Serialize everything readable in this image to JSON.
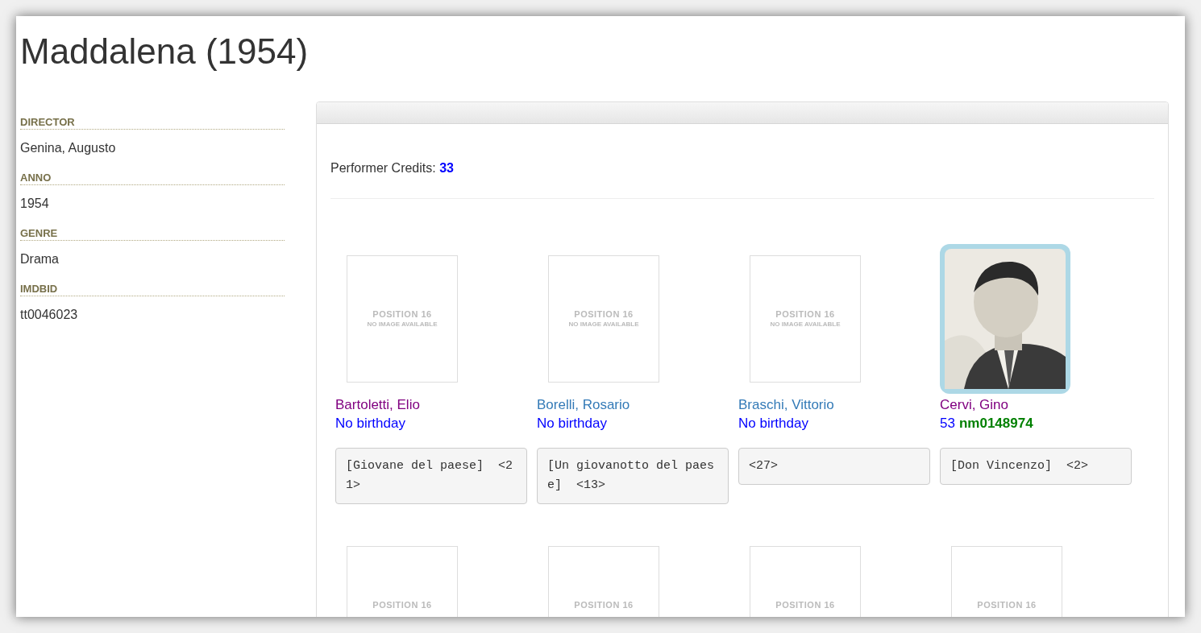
{
  "title": "Maddalena (1954)",
  "details": [
    {
      "label": "DIRECTOR",
      "value": "Genina, Augusto"
    },
    {
      "label": "ANNO",
      "value": "1954"
    },
    {
      "label": "GENRE",
      "value": "Drama"
    },
    {
      "label": "IMDBID",
      "value": "tt0046023"
    }
  ],
  "credits": {
    "label": "Performer Credits:",
    "count": "33"
  },
  "performers": [
    {
      "image": {
        "kind": "placeholder",
        "line_1": "POSITION 16",
        "line_2": "NO IMAGE AVAILABLE"
      },
      "name": "Bartoletti, Elio",
      "visited": true,
      "birthday": {
        "kind": "none",
        "text": "No birthday"
      },
      "role": "[Giovane del paese]  <21>"
    },
    {
      "image": {
        "kind": "placeholder",
        "line_1": "POSITION 16",
        "line_2": "NO IMAGE AVAILABLE"
      },
      "name": "Borelli, Rosario",
      "visited": false,
      "birthday": {
        "kind": "none",
        "text": "No birthday"
      },
      "role": "[Un giovanotto del paese]  <13>"
    },
    {
      "image": {
        "kind": "placeholder",
        "line_1": "POSITION 16",
        "line_2": "NO IMAGE AVAILABLE"
      },
      "name": "Braschi, Vittorio",
      "visited": false,
      "birthday": {
        "kind": "none",
        "text": "No birthday"
      },
      "role": "<27>"
    },
    {
      "name": "Cervi, Gino",
      "visited": true,
      "birthday": {
        "kind": "age",
        "text": "53",
        "imdb": "nm0148974"
      },
      "role": "[Don Vincenzo]  <2>"
    },
    {
      "image": {
        "kind": "placeholder",
        "line_1": "POSITION 16"
      }
    },
    {
      "image": {
        "kind": "placeholder",
        "line_1": "POSITION 16"
      }
    },
    {
      "image": {
        "kind": "placeholder",
        "line_1": "POSITION 16"
      }
    },
    {
      "image": {
        "kind": "placeholder",
        "line_1": "POSITION 16"
      }
    }
  ]
}
